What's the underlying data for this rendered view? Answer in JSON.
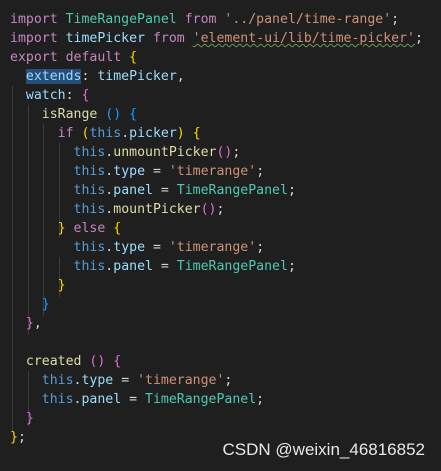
{
  "editor": {
    "lines": [
      [
        [
          "kw-ctrl",
          "import"
        ],
        [
          "punc",
          " "
        ],
        [
          "cls",
          "TimeRangePanel"
        ],
        [
          "punc",
          " "
        ],
        [
          "kw-ctrl",
          "from"
        ],
        [
          "punc",
          " "
        ],
        [
          "str",
          "'../panel/time-range'"
        ],
        [
          "punc",
          ";"
        ]
      ],
      [
        [
          "kw-ctrl",
          "import"
        ],
        [
          "punc",
          " "
        ],
        [
          "var",
          "timePicker"
        ],
        [
          "punc",
          " "
        ],
        [
          "kw-ctrl",
          "from"
        ],
        [
          "punc",
          " "
        ],
        [
          "str squig",
          "'element-ui/lib/time-picker'"
        ],
        [
          "punc",
          ";"
        ]
      ],
      [
        [
          "kw-ctrl",
          "export"
        ],
        [
          "punc",
          " "
        ],
        [
          "kw-ctrl",
          "default"
        ],
        [
          "punc",
          " "
        ],
        [
          "p1",
          "{"
        ]
      ],
      [
        [
          "punc",
          "  "
        ],
        [
          "var hl",
          "extends"
        ],
        [
          "punc",
          ": "
        ],
        [
          "var",
          "timePicker"
        ],
        [
          "punc",
          ","
        ]
      ],
      [
        [
          "punc",
          "  "
        ],
        [
          "var",
          "watch"
        ],
        [
          "punc",
          ": "
        ],
        [
          "p2",
          "{"
        ]
      ],
      [
        [
          "punc",
          "    "
        ],
        [
          "fn",
          "isRange"
        ],
        [
          "punc",
          " "
        ],
        [
          "p3",
          "()"
        ],
        [
          "punc",
          " "
        ],
        [
          "p3",
          "{"
        ]
      ],
      [
        [
          "punc",
          "      "
        ],
        [
          "kw-ctrl",
          "if"
        ],
        [
          "punc",
          " "
        ],
        [
          "p1",
          "("
        ],
        [
          "kw",
          "this"
        ],
        [
          "punc",
          "."
        ],
        [
          "var",
          "picker"
        ],
        [
          "p1",
          ")"
        ],
        [
          "punc",
          " "
        ],
        [
          "p1",
          "{"
        ]
      ],
      [
        [
          "punc",
          "        "
        ],
        [
          "kw",
          "this"
        ],
        [
          "punc",
          "."
        ],
        [
          "fn",
          "unmountPicker"
        ],
        [
          "p2",
          "()"
        ],
        [
          "punc",
          ";"
        ]
      ],
      [
        [
          "punc",
          "        "
        ],
        [
          "kw",
          "this"
        ],
        [
          "punc",
          "."
        ],
        [
          "var",
          "type"
        ],
        [
          "punc",
          " = "
        ],
        [
          "str",
          "'timerange'"
        ],
        [
          "punc",
          ";"
        ]
      ],
      [
        [
          "punc",
          "        "
        ],
        [
          "kw",
          "this"
        ],
        [
          "punc",
          "."
        ],
        [
          "var",
          "panel"
        ],
        [
          "punc",
          " = "
        ],
        [
          "cls",
          "TimeRangePanel"
        ],
        [
          "punc",
          ";"
        ]
      ],
      [
        [
          "punc",
          "        "
        ],
        [
          "kw",
          "this"
        ],
        [
          "punc",
          "."
        ],
        [
          "fn",
          "mountPicker"
        ],
        [
          "p2",
          "()"
        ],
        [
          "punc",
          ";"
        ]
      ],
      [
        [
          "punc",
          "      "
        ],
        [
          "p1",
          "}"
        ],
        [
          "punc",
          " "
        ],
        [
          "kw-ctrl",
          "else"
        ],
        [
          "punc",
          " "
        ],
        [
          "p1",
          "{"
        ]
      ],
      [
        [
          "punc",
          "        "
        ],
        [
          "kw",
          "this"
        ],
        [
          "punc",
          "."
        ],
        [
          "var",
          "type"
        ],
        [
          "punc",
          " = "
        ],
        [
          "str",
          "'timerange'"
        ],
        [
          "punc",
          ";"
        ]
      ],
      [
        [
          "punc",
          "        "
        ],
        [
          "kw",
          "this"
        ],
        [
          "punc",
          "."
        ],
        [
          "var",
          "panel"
        ],
        [
          "punc",
          " = "
        ],
        [
          "cls",
          "TimeRangePanel"
        ],
        [
          "punc",
          ";"
        ]
      ],
      [
        [
          "punc",
          "      "
        ],
        [
          "p1",
          "}"
        ]
      ],
      [
        [
          "punc",
          "    "
        ],
        [
          "p3",
          "}"
        ]
      ],
      [
        [
          "punc",
          "  "
        ],
        [
          "p2",
          "}"
        ],
        [
          "punc",
          ","
        ]
      ],
      [
        [
          "punc",
          " "
        ]
      ],
      [
        [
          "punc",
          "  "
        ],
        [
          "fn",
          "created"
        ],
        [
          "punc",
          " "
        ],
        [
          "p2",
          "()"
        ],
        [
          "punc",
          " "
        ],
        [
          "p2",
          "{"
        ]
      ],
      [
        [
          "punc",
          "    "
        ],
        [
          "kw",
          "this"
        ],
        [
          "punc",
          "."
        ],
        [
          "var",
          "type"
        ],
        [
          "punc",
          " = "
        ],
        [
          "str",
          "'timerange'"
        ],
        [
          "punc",
          ";"
        ]
      ],
      [
        [
          "punc",
          "    "
        ],
        [
          "kw",
          "this"
        ],
        [
          "punc",
          "."
        ],
        [
          "var",
          "panel"
        ],
        [
          "punc",
          " = "
        ],
        [
          "cls",
          "TimeRangePanel"
        ],
        [
          "punc",
          ";"
        ]
      ],
      [
        [
          "punc",
          "  "
        ],
        [
          "p2",
          "}"
        ]
      ],
      [
        [
          "p1",
          "}"
        ],
        [
          "punc",
          ";"
        ]
      ]
    ]
  },
  "watermark": "CSDN @weixin_46816852"
}
